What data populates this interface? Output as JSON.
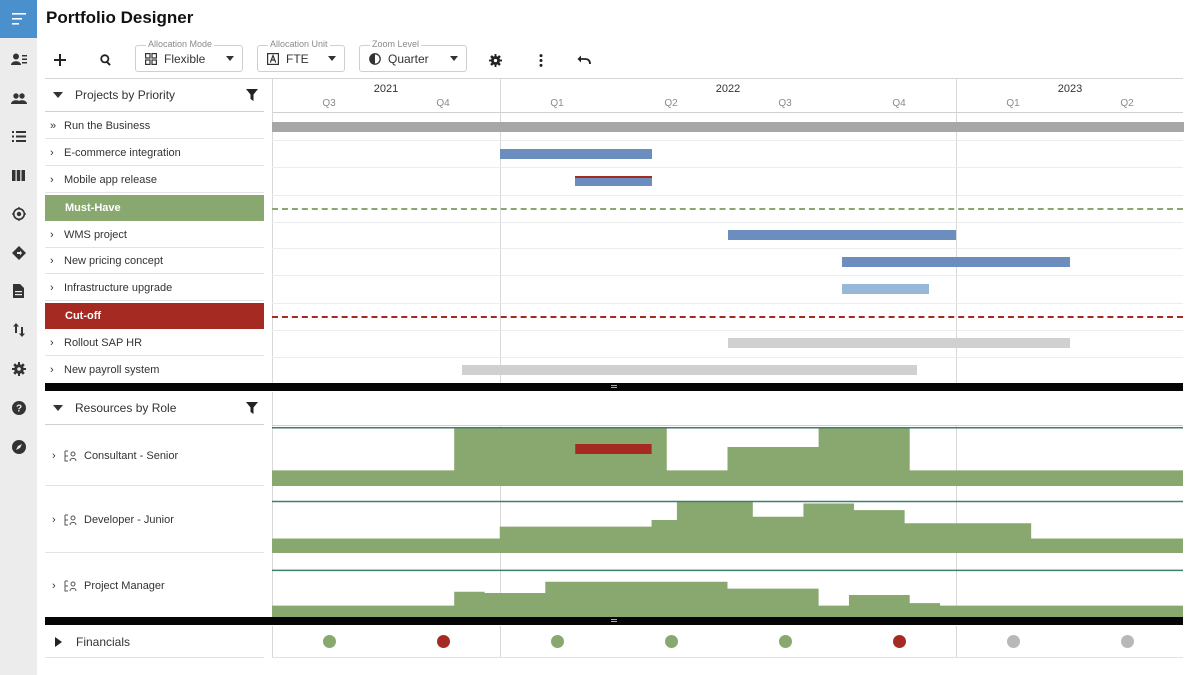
{
  "app": {
    "title": "Portfolio Designer"
  },
  "rail": {
    "top_icon": "menu-icon",
    "items": [
      {
        "name": "user-list-icon"
      },
      {
        "name": "people-icon"
      },
      {
        "name": "list-icon"
      },
      {
        "name": "columns-icon"
      },
      {
        "name": "target-icon"
      },
      {
        "name": "diamond-direction-icon"
      },
      {
        "name": "document-icon"
      },
      {
        "name": "swap-vertical-icon"
      },
      {
        "name": "settings-icon"
      },
      {
        "name": "help-icon"
      },
      {
        "name": "compass-icon"
      }
    ]
  },
  "toolbar": {
    "allocation_mode": {
      "legend": "Allocation Mode",
      "value": "Flexible",
      "icon": "grid-icon"
    },
    "allocation_unit": {
      "legend": "Allocation Unit",
      "value": "FTE",
      "icon": "letter-a-icon"
    },
    "zoom_level": {
      "legend": "Zoom Level",
      "value": "Quarter",
      "icon": "contrast-icon"
    }
  },
  "timeline": {
    "years": [
      "2021",
      "2022",
      "2023"
    ],
    "quarters": [
      "Q3",
      "Q4",
      "Q1",
      "Q2",
      "Q3",
      "Q4",
      "Q1",
      "Q2"
    ]
  },
  "projects": {
    "header": "Projects by Priority",
    "rows": [
      {
        "label": "Run the Business",
        "type": "project-double"
      },
      {
        "label": "E-commerce integration",
        "type": "project"
      },
      {
        "label": "Mobile app release",
        "type": "project"
      },
      {
        "label": "Must-Have",
        "type": "band",
        "color": "#88a86f"
      },
      {
        "label": "WMS project",
        "type": "project"
      },
      {
        "label": "New pricing concept",
        "type": "project"
      },
      {
        "label": "Infrastructure upgrade",
        "type": "project"
      },
      {
        "label": "Cut-off",
        "type": "band",
        "color": "#a52a22"
      },
      {
        "label": "Rollout SAP HR",
        "type": "project"
      },
      {
        "label": "New payroll system",
        "type": "project"
      }
    ]
  },
  "resources": {
    "header": "Resources by Role",
    "rows": [
      {
        "label": "Consultant - Senior"
      },
      {
        "label": "Developer - Junior"
      },
      {
        "label": "Project Manager"
      }
    ]
  },
  "financials": {
    "label": "Financials",
    "status": [
      "green",
      "red",
      "green",
      "green",
      "green",
      "red",
      "grey",
      "grey"
    ]
  },
  "colors": {
    "accent": "#4a90cc",
    "bar_blue": "#6c8ebf",
    "bar_light_blue": "#98b8da",
    "bar_grey": "#a7a7a7",
    "bar_light_grey": "#d0d0d0",
    "over_red": "#a52a22",
    "green": "#88a86f",
    "status_green": "#88a86f",
    "status_red": "#a52a22",
    "status_grey": "#b8b8b8"
  }
}
